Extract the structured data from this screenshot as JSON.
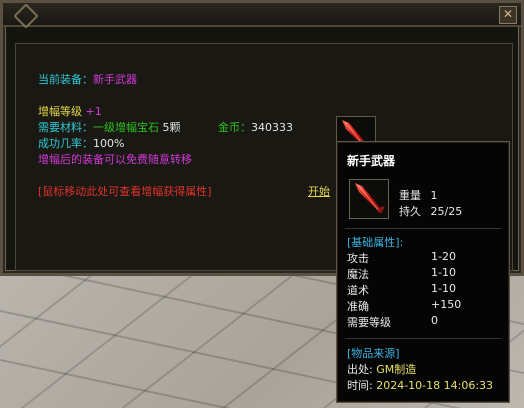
{
  "dialog": {
    "current_equip_label": "当前装备：",
    "current_equip_value": "新手武器",
    "level_label": "增幅等级",
    "level_value": "+1",
    "material_label": "需要材料：",
    "material_value": "一级增幅宝石",
    "material_count": "5颗",
    "gold_label": "金币：",
    "gold_value": "340333",
    "rate_label": "成功几率：",
    "rate_value": "100%",
    "note": "增幅后的装备可以免费随意转移",
    "hint": "[鼠标移动此处可查看增幅获得属性]",
    "start_button": "开始"
  },
  "tooltip": {
    "title": "新手武器",
    "weight_label": "重量",
    "weight_value": "1",
    "durability_label": "持久",
    "durability_value": "25/25",
    "base_section": "[基础属性]:",
    "stats": [
      {
        "label": "攻击",
        "value": "1-20"
      },
      {
        "label": "魔法",
        "value": "1-10"
      },
      {
        "label": "道术",
        "value": "1-10"
      },
      {
        "label": "准确",
        "value": "+150"
      },
      {
        "label": "需要等级",
        "value": "0"
      }
    ],
    "source_section": "[物品来源]",
    "origin_label": "出处:",
    "origin_value": "GM制造",
    "time_label": "时间:",
    "time_value": "2024-10-18 14:06:33"
  },
  "colors": {
    "label_cyan": "#31c7d6",
    "level_yellow": "#e6d84a",
    "magenta": "#d23ad8",
    "material_green": "#2cc21f",
    "hint_red": "#e0332b",
    "section_blue": "#3db5e4"
  },
  "icons": {
    "close": "close-icon",
    "weapon": "red-sword-icon"
  }
}
